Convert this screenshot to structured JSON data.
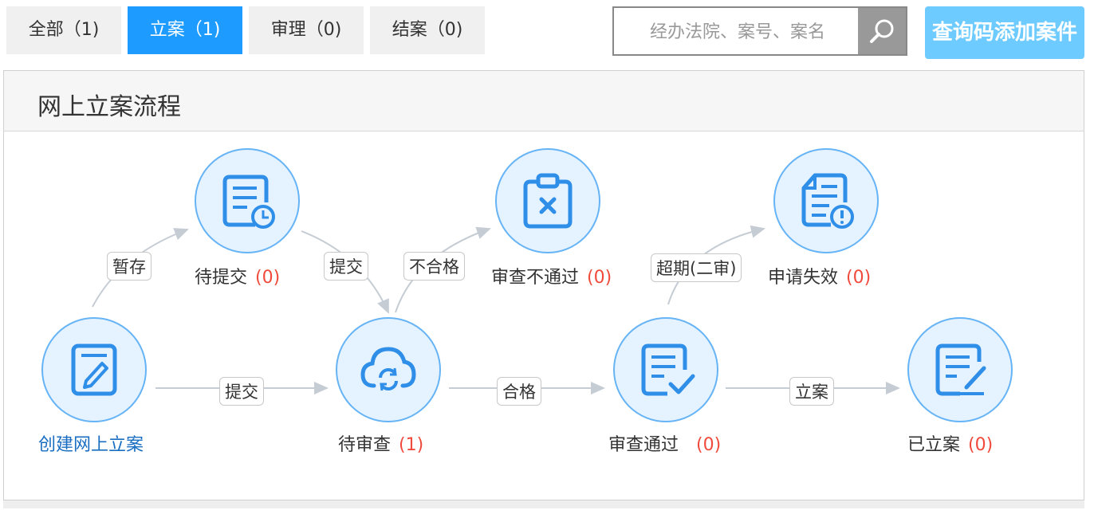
{
  "tabs": [
    {
      "label": "全部（1)",
      "active": false
    },
    {
      "label": "立案（1)",
      "active": true
    },
    {
      "label": "审理（0)",
      "active": false
    },
    {
      "label": "结案（0)",
      "active": false
    }
  ],
  "search": {
    "placeholder": "经办法院、案号、案名",
    "icon": "search-icon"
  },
  "add_button": {
    "label": "查询码添加案件"
  },
  "panel": {
    "title": "网上立案流程"
  },
  "nodes": {
    "create": {
      "label": "创建网上立案",
      "icon": "edit-form-icon"
    },
    "pending_submit": {
      "label": "待提交",
      "count": "(0)",
      "icon": "document-clock-icon"
    },
    "pending_review": {
      "label": "待审查",
      "count": "(1)",
      "icon": "cloud-sync-icon"
    },
    "review_failed": {
      "label": "审查不通过",
      "count": "(0)",
      "icon": "clipboard-x-icon"
    },
    "review_passed": {
      "label": "审查通过",
      "count": "(0)",
      "icon": "document-check-icon"
    },
    "expired": {
      "label": "申请失效",
      "count": "(0)",
      "icon": "document-alert-icon"
    },
    "filed": {
      "label": "已立案",
      "count": "(0)",
      "icon": "document-pen-icon"
    }
  },
  "edges": {
    "save_draft": "暂存",
    "submit_from_draft": "提交",
    "submit": "提交",
    "unqualified": "不合格",
    "qualified": "合格",
    "overdue": "超期(二审)",
    "file_case": "立案"
  },
  "colors": {
    "accent": "#1e9bff",
    "node_fill": "#e5f2ff",
    "node_border": "#66b4f5",
    "icon": "#2e8ee8",
    "count": "#f04a3c",
    "link": "#1a6ec2"
  }
}
